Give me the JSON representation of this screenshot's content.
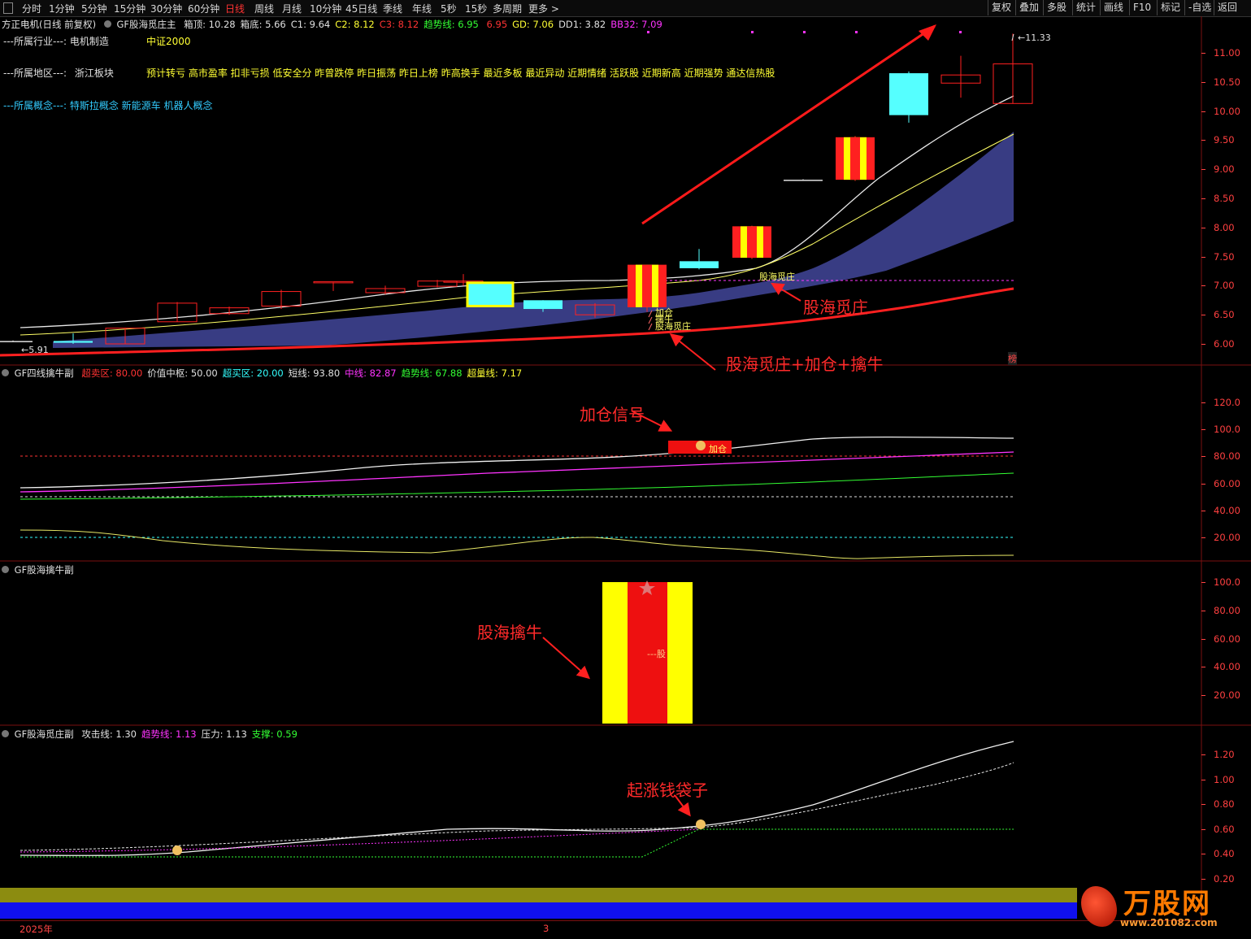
{
  "toolbar": {
    "periods": [
      "分时",
      "1分钟",
      "5分钟",
      "15分钟",
      "30分钟",
      "60分钟",
      "日线",
      "周线",
      "月线",
      "10分钟",
      "45日线",
      "季线",
      "年线",
      "5秒",
      "15秒",
      "多周期",
      "更多 >"
    ],
    "active_period": "日线",
    "right_buttons": [
      "复权",
      "叠加",
      "多股",
      "统计",
      "画线",
      "F10",
      "标记",
      "-自选",
      "返回"
    ]
  },
  "main_panel": {
    "stock": "方正电机(日线 前复权)",
    "indicator": "GF股海觅庄主",
    "params": [
      {
        "label": "箱顶:",
        "value": "10.28",
        "color": "#e0e0e0"
      },
      {
        "label": "箱底:",
        "value": "5.66",
        "color": "#e0e0e0"
      },
      {
        "label": "C1:",
        "value": "9.64",
        "color": "#e0e0e0"
      },
      {
        "label": "C2:",
        "value": "8.12",
        "color": "#ffff33"
      },
      {
        "label": "C3:",
        "value": "8.12",
        "color": "#ff3333"
      },
      {
        "label": "趋势线:",
        "value": "6.95",
        "color": "#33ff33"
      },
      {
        "label": "",
        "value": "6.95",
        "color": "#ff3333"
      },
      {
        "label": "GD:",
        "value": "7.06",
        "color": "#ffff33"
      },
      {
        "label": "DD1:",
        "value": "3.82",
        "color": "#e0e0e0"
      },
      {
        "label": "BB32:",
        "value": "7.09",
        "color": "#ff33ff"
      }
    ],
    "industry_label": "---所属行业---:",
    "industry": "电机制造",
    "index": "中证2000",
    "region_label": "---所属地区---:",
    "region": "浙江板块",
    "tags": "预计转亏 高市盈率 扣非亏损 低安全分 昨曾跌停 昨日振荡 昨日上榜 昨高换手 最近多板 最近异动 近期情绪 活跃股 近期新高 近期强势 通达信热股",
    "concept_label": "---所属概念---:",
    "concepts": "特斯拉概念 新能源车 机器人概念",
    "high_label": "11.33",
    "low_label": "5.91",
    "axis": [
      "11.00",
      "10.50",
      "10.00",
      "9.50",
      "9.00",
      "8.50",
      "8.00",
      "7.50",
      "7.00",
      "6.50",
      "6.00"
    ],
    "signal_texts": [
      "加仓",
      "擒牛",
      "股海觅庄",
      "股海觅庄"
    ],
    "bang": "榜",
    "annot_right": "股海觅庄",
    "annot_bottom": "股海觅庄+加仓+擒牛"
  },
  "panel2": {
    "title": "GF四线擒牛副",
    "params": [
      {
        "label": "超卖区:",
        "value": "80.00",
        "color": "#ff3333"
      },
      {
        "label": "价值中枢:",
        "value": "50.00",
        "color": "#e0e0e0"
      },
      {
        "label": "超买区:",
        "value": "20.00",
        "color": "#33ffff"
      },
      {
        "label": "短线:",
        "value": "93.80",
        "color": "#e0e0e0"
      },
      {
        "label": "中线:",
        "value": "82.87",
        "color": "#ff33ff"
      },
      {
        "label": "趋势线:",
        "value": "67.88",
        "color": "#33ff33"
      },
      {
        "label": "超量线:",
        "value": "7.17",
        "color": "#ffff33"
      }
    ],
    "axis": [
      "120.0",
      "100.0",
      "80.00",
      "60.00",
      "40.00",
      "20.00"
    ],
    "signal": "加仓",
    "annot": "加仓信号"
  },
  "panel3": {
    "title": "GF股海擒牛副",
    "axis": [
      "100.0",
      "80.00",
      "60.00",
      "40.00",
      "20.00"
    ],
    "bar_text": "---股",
    "annot": "股海擒牛"
  },
  "panel4": {
    "title": "GF股海觅庄副",
    "params": [
      {
        "label": "攻击线:",
        "value": "1.30",
        "color": "#e0e0e0"
      },
      {
        "label": "趋势线:",
        "value": "1.13",
        "color": "#ff33ff"
      },
      {
        "label": "压力:",
        "value": "1.13",
        "color": "#e0e0e0"
      },
      {
        "label": "支撑:",
        "value": "0.59",
        "color": "#33ff33"
      }
    ],
    "axis": [
      "1.20",
      "1.00",
      "0.80",
      "0.60",
      "0.40",
      "0.20"
    ],
    "annot": "起涨钱袋子"
  },
  "timeline": {
    "year": "2025年",
    "month": "3"
  },
  "watermark": {
    "brand": "万股网",
    "url": "www.201082.com"
  },
  "colors": {
    "up": "#ff2020",
    "down": "#55ffff",
    "band": "#3b3f8a",
    "axis": "#ff4444"
  }
}
